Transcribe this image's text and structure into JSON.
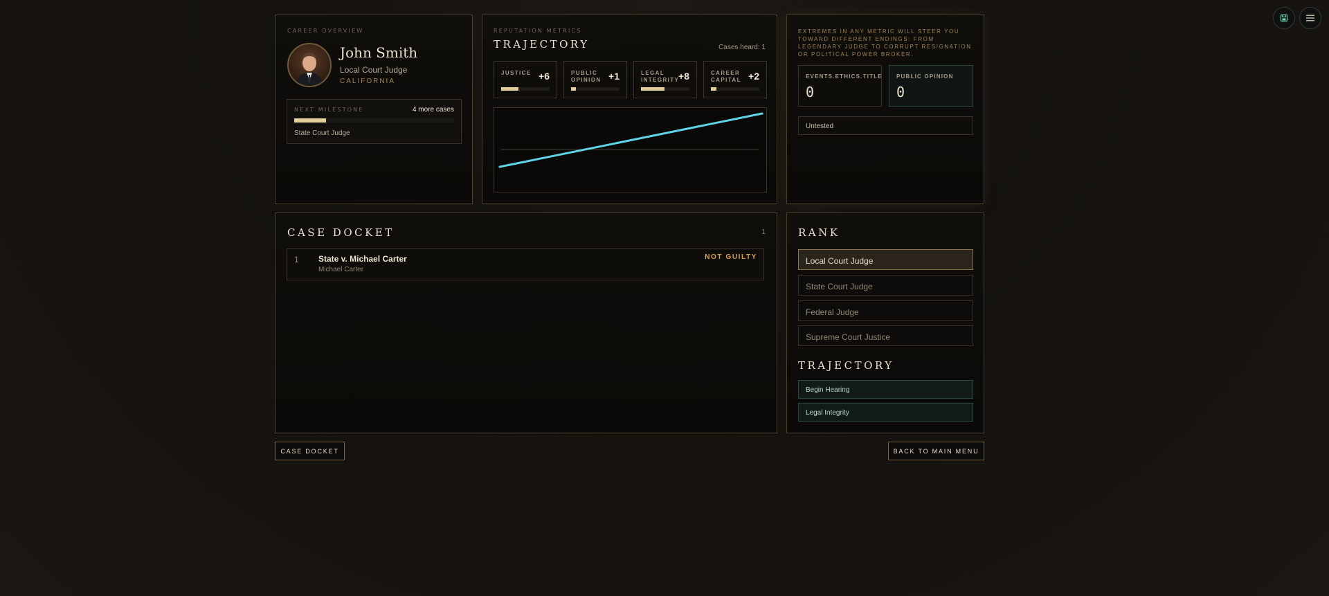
{
  "controls": {
    "save_icon": "save-icon",
    "menu_icon": "menu-icon"
  },
  "career": {
    "eyebrow": "CAREER OVERVIEW",
    "name": "John Smith",
    "title": "Local Court Judge",
    "state": "CALIFORNIA",
    "milestone": {
      "label": "NEXT MILESTONE",
      "remaining": "4 more cases",
      "progress": 0.2,
      "target": "State Court Judge"
    }
  },
  "metrics": {
    "eyebrow": "REPUTATION METRICS",
    "heading": "TRAJECTORY",
    "cases_heard": "Cases heard: 1",
    "items": [
      {
        "label": "JUSTICE",
        "value": "+6",
        "level": 0.36
      },
      {
        "label": "PUBLIC OPINION",
        "value": "+1",
        "level": 0.1
      },
      {
        "label": "LEGAL INTEGRITY",
        "value": "+8",
        "level": 0.48
      },
      {
        "label": "CAREER CAPITAL",
        "value": "+2",
        "level": 0.12
      }
    ]
  },
  "chart_data": {
    "type": "line",
    "title": "",
    "xlabel": "",
    "ylabel": "",
    "grid": false,
    "series": [
      {
        "values": [
          -0.62,
          1.0
        ],
        "color": "#5fd3e8"
      }
    ],
    "reference_line": 0
  },
  "endings": {
    "note": "EXTREMES IN ANY METRIC WILL STEER YOU TOWARD DIFFERENT ENDINGS: FROM LEGENDARY JUDGE TO CORRUPT RESIGNATION OR POLITICAL POWER BROKER.",
    "ethics": {
      "label": "EVENTS.ETHICS.TITLE",
      "value": "0"
    },
    "public_opinion": {
      "label": "PUBLIC OPINION",
      "value": "0"
    },
    "status": "Untested"
  },
  "docket": {
    "heading": "CASE DOCKET",
    "count": "1",
    "cases": [
      {
        "number": "1",
        "title": "State v. Michael Carter",
        "defendant": "Michael Carter",
        "verdict": "NOT GUILTY"
      }
    ]
  },
  "rank": {
    "heading": "RANK",
    "items": [
      "Local Court Judge",
      "State Court Judge",
      "Federal Judge",
      "Supreme Court Justice"
    ],
    "active_index": 0
  },
  "trajectory": {
    "heading": "TRAJECTORY",
    "items": [
      "Begin Hearing",
      "Legal Integrity"
    ]
  },
  "footer": {
    "case_docket_button": "CASE DOCKET",
    "back_button": "BACK TO MAIN MENU"
  },
  "colors": {
    "accent_gold": "#e3cf9b",
    "verdict": "#d9a24a",
    "chart_line": "#5fd3e8",
    "teal_border": "#2b4a3f"
  }
}
